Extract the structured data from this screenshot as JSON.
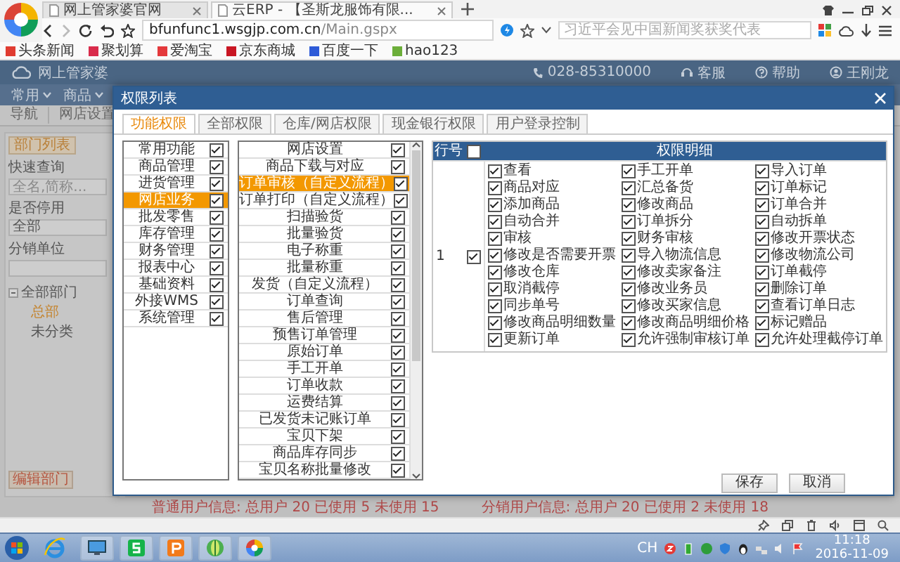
{
  "browser": {
    "tabs": [
      {
        "title": "网上管家婆官网",
        "selected": false
      },
      {
        "title": "云ERP - 【圣斯龙服饰有限...",
        "selected": true
      }
    ],
    "url": "**bfunfunc1.wsgjp.com.cn**/Main.gspx",
    "search": {
      "placeholder": "习近平会见中国新闻奖获奖代表"
    },
    "bookmarks": [
      {
        "label": "头条新闻",
        "color": "#e03c31"
      },
      {
        "label": "聚划算",
        "color": "#d92b4b"
      },
      {
        "label": "爱淘宝",
        "color": "#e4393c"
      },
      {
        "label": "京东商城",
        "color": "#c91623"
      },
      {
        "label": "百度一下",
        "color": "#2e5bd8"
      },
      {
        "label": "hao123",
        "color": "#6cae3a"
      }
    ]
  },
  "app": {
    "logo": "网上管家婆",
    "phone": "028-85310000",
    "links": [
      {
        "label": "客服",
        "kind": "service"
      },
      {
        "label": "帮助",
        "kind": "help"
      },
      {
        "label": "王刚龙",
        "kind": "user"
      }
    ],
    "menu": [
      "常用",
      "商品"
    ],
    "page_tabs": [
      "导航",
      "网店设置"
    ],
    "left_panel": {
      "title": "部门列表",
      "search_label": "快速查询",
      "search_placeholder": "全名,简称...",
      "status_label": "是否停用",
      "status_value": "全部",
      "unit_label": "分销单位",
      "tree": [
        {
          "label": "全部部门",
          "expanded": true,
          "selected": false,
          "children": [
            {
              "label": "总部",
              "selected": true
            },
            {
              "label": "未分类",
              "selected": false
            }
          ]
        }
      ],
      "footer_button": "编辑部门"
    },
    "usage": [
      "普通用户信息: 总用户 20 已使用 5 未使用 15",
      "分销用户信息: 总用户 20 已使用 2 未使用 18"
    ]
  },
  "dialog": {
    "title": "权限列表",
    "tabs": [
      {
        "label": "功能权限",
        "selected": true
      },
      {
        "label": "全部权限",
        "selected": false
      },
      {
        "label": "仓库/网店权限",
        "selected": false
      },
      {
        "label": "现金银行权限",
        "selected": false
      },
      {
        "label": "用户登录控制",
        "selected": false
      }
    ],
    "modules": [
      {
        "label": "常用功能",
        "checked": true,
        "selected": false
      },
      {
        "label": "商品管理",
        "checked": true,
        "selected": false
      },
      {
        "label": "进货管理",
        "checked": true,
        "selected": false
      },
      {
        "label": "网店业务",
        "checked": true,
        "selected": true
      },
      {
        "label": "批发零售",
        "checked": true,
        "selected": false
      },
      {
        "label": "库存管理",
        "checked": true,
        "selected": false
      },
      {
        "label": "财务管理",
        "checked": true,
        "selected": false
      },
      {
        "label": "报表中心",
        "checked": true,
        "selected": false
      },
      {
        "label": "基础资料",
        "checked": true,
        "selected": false
      },
      {
        "label": "外接WMS",
        "checked": true,
        "selected": false
      },
      {
        "label": "系统管理",
        "checked": true,
        "selected": false
      }
    ],
    "functions": [
      {
        "label": "网店设置",
        "checked": true,
        "selected": false
      },
      {
        "label": "商品下载与对应",
        "checked": true,
        "selected": false
      },
      {
        "label": "订单审核（自定义流程）",
        "checked": true,
        "selected": true
      },
      {
        "label": "订单打印（自定义流程）",
        "checked": true,
        "selected": false
      },
      {
        "label": "扫描验货",
        "checked": true,
        "selected": false
      },
      {
        "label": "批量验货",
        "checked": true,
        "selected": false
      },
      {
        "label": "电子称重",
        "checked": true,
        "selected": false
      },
      {
        "label": "批量称重",
        "checked": true,
        "selected": false
      },
      {
        "label": "发货（自定义流程）",
        "checked": true,
        "selected": false
      },
      {
        "label": "订单查询",
        "checked": true,
        "selected": false
      },
      {
        "label": "售后管理",
        "checked": true,
        "selected": false
      },
      {
        "label": "预售订单管理",
        "checked": true,
        "selected": false
      },
      {
        "label": "原始订单",
        "checked": true,
        "selected": false
      },
      {
        "label": "手工开单",
        "checked": true,
        "selected": false
      },
      {
        "label": "订单收款",
        "checked": true,
        "selected": false
      },
      {
        "label": "运费结算",
        "checked": true,
        "selected": false
      },
      {
        "label": "已发货未记账订单",
        "checked": true,
        "selected": false
      },
      {
        "label": "宝贝下架",
        "checked": true,
        "selected": false
      },
      {
        "label": "商品库存同步",
        "checked": true,
        "selected": false
      },
      {
        "label": "宝贝名称批量修改",
        "checked": true,
        "selected": false
      }
    ],
    "table": {
      "columns": [
        "行号",
        "权限明细"
      ],
      "header_checked": false,
      "rows": [
        {
          "number": "1",
          "checked": true,
          "permissions": [
            {
              "label": "查看",
              "checked": true
            },
            {
              "label": "手工开单",
              "checked": true
            },
            {
              "label": "导入订单",
              "checked": true
            },
            {
              "label": "商品对应",
              "checked": true
            },
            {
              "label": "汇总备货",
              "checked": true
            },
            {
              "label": "订单标记",
              "checked": true
            },
            {
              "label": "添加商品",
              "checked": true
            },
            {
              "label": "修改商品",
              "checked": true
            },
            {
              "label": "订单合并",
              "checked": true
            },
            {
              "label": "自动合并",
              "checked": true
            },
            {
              "label": "订单拆分",
              "checked": true
            },
            {
              "label": "自动拆单",
              "checked": true
            },
            {
              "label": "审核",
              "checked": true
            },
            {
              "label": "财务审核",
              "checked": true
            },
            {
              "label": "修改开票状态",
              "checked": true
            },
            {
              "label": "修改是否需要开票",
              "checked": true
            },
            {
              "label": "导入物流信息",
              "checked": true
            },
            {
              "label": "修改物流公司",
              "checked": true
            },
            {
              "label": "修改仓库",
              "checked": true
            },
            {
              "label": "修改卖家备注",
              "checked": true
            },
            {
              "label": "订单截停",
              "checked": true
            },
            {
              "label": "取消截停",
              "checked": true
            },
            {
              "label": "修改业务员",
              "checked": true
            },
            {
              "label": "删除订单",
              "checked": true
            },
            {
              "label": "同步单号",
              "checked": true
            },
            {
              "label": "修改买家信息",
              "checked": true
            },
            {
              "label": "查看订单日志",
              "checked": true
            },
            {
              "label": "修改商品明细数量",
              "checked": true
            },
            {
              "label": "修改商品明细价格",
              "checked": true
            },
            {
              "label": "标记赠品",
              "checked": true
            },
            {
              "label": "更新订单",
              "checked": true
            },
            {
              "label": "允许强制审核订单",
              "checked": true
            },
            {
              "label": "允许处理截停订单",
              "checked": true
            }
          ]
        }
      ]
    },
    "buttons": [
      "保存",
      "取消"
    ]
  },
  "taskbar": {
    "ime": "CH",
    "time": "11:18",
    "date": "2016-11-09"
  }
}
